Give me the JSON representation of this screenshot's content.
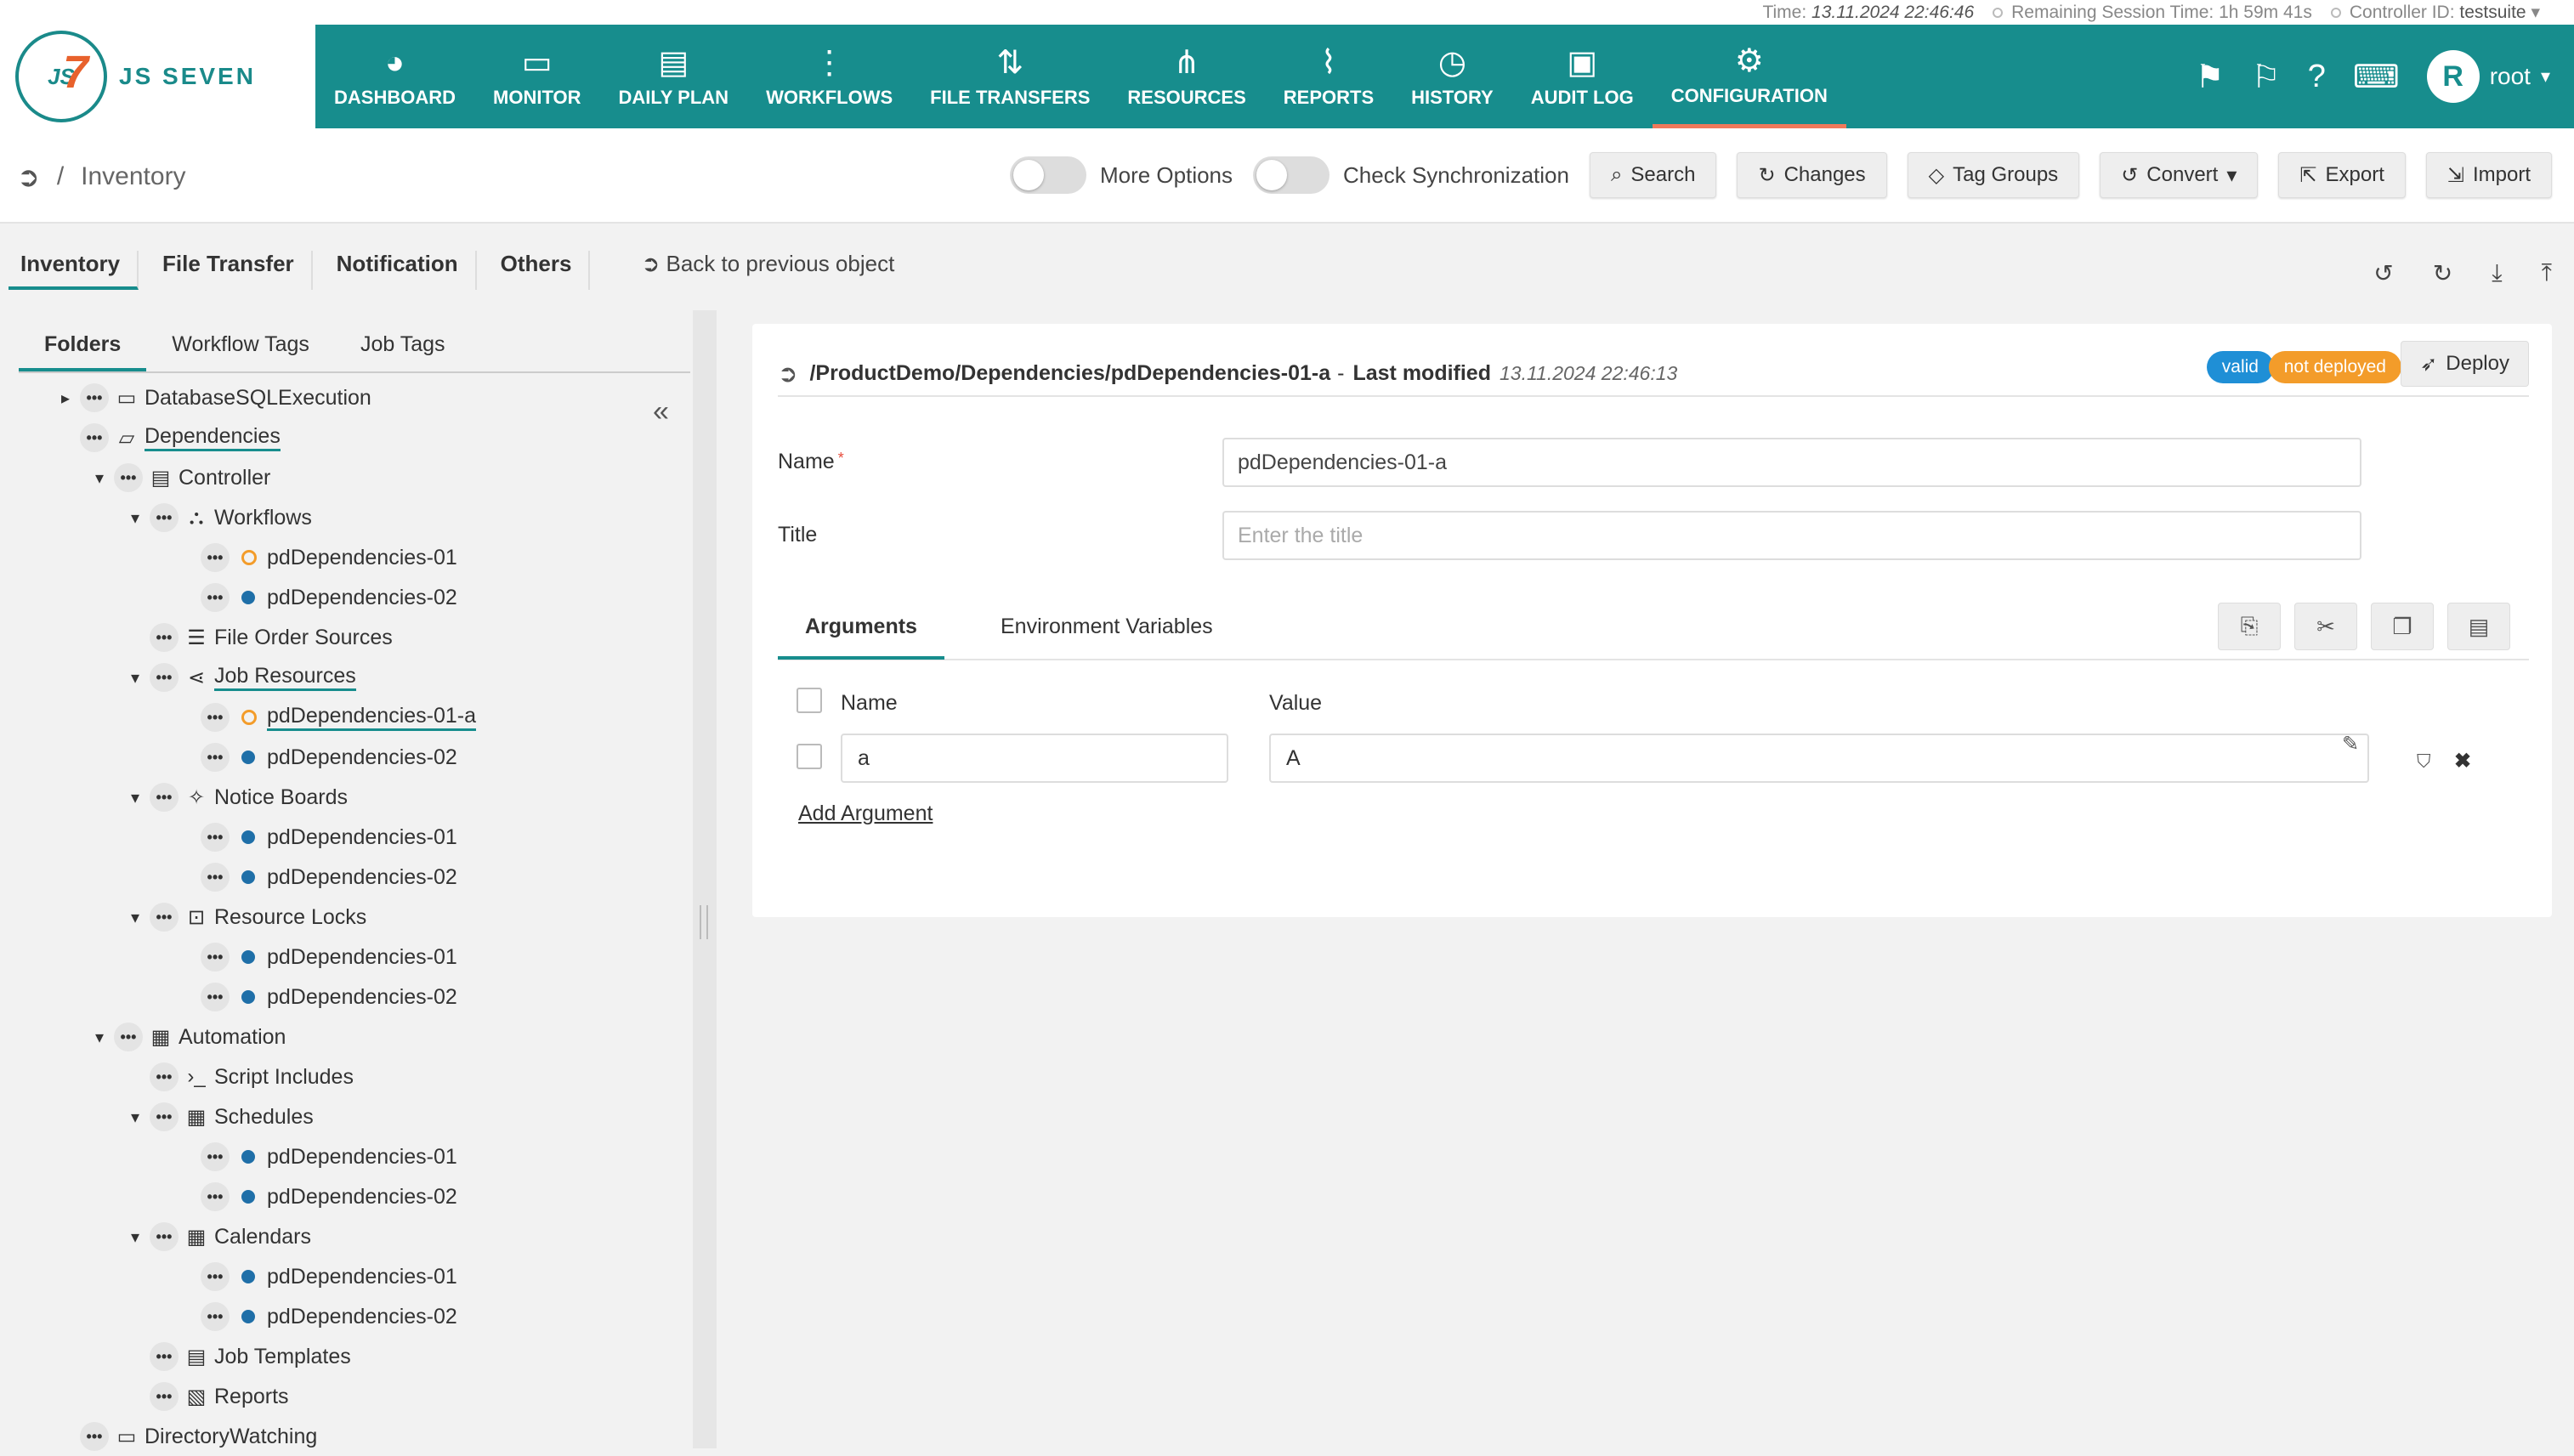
{
  "status": {
    "time_label": "Time:",
    "time_value": "13.11.2024 22:46:46",
    "session_label": "Remaining Session Time:",
    "session_value": "1h 59m 41s",
    "controller_label": "Controller ID:",
    "controller_value": "testsuite"
  },
  "logo": {
    "mark": "JS",
    "seven": "7",
    "word": "JS SEVEN"
  },
  "nav": {
    "items": [
      {
        "label": "DASHBOARD",
        "icon": "◕"
      },
      {
        "label": "MONITOR",
        "icon": "▭"
      },
      {
        "label": "DAILY PLAN",
        "icon": "▤"
      },
      {
        "label": "WORKFLOWS",
        "icon": "⋮"
      },
      {
        "label": "FILE TRANSFERS",
        "icon": "⇅"
      },
      {
        "label": "RESOURCES",
        "icon": "⋔"
      },
      {
        "label": "REPORTS",
        "icon": "⌇"
      },
      {
        "label": "HISTORY",
        "icon": "◷"
      },
      {
        "label": "AUDIT LOG",
        "icon": "▣"
      },
      {
        "label": "CONFIGURATION",
        "icon": "⚙"
      }
    ],
    "active": "CONFIGURATION",
    "user": {
      "initial": "R",
      "name": "root"
    }
  },
  "toolbar": {
    "breadcrumb": "Inventory",
    "more_options": "More Options",
    "check_sync": "Check Synchronization",
    "search": "Search",
    "changes": "Changes",
    "tag_groups": "Tag Groups",
    "convert": "Convert",
    "export": "Export",
    "import": "Import"
  },
  "tabs": {
    "items": [
      "Inventory",
      "File Transfer",
      "Notification",
      "Others"
    ],
    "back_prev": "Back to previous object"
  },
  "sidebar": {
    "tabs": [
      "Folders",
      "Workflow Tags",
      "Job Tags"
    ],
    "tree": [
      {
        "label": "DatabaseSQLExecution",
        "level": 0,
        "arrow": "▸",
        "icon": "folder"
      },
      {
        "label": "Dependencies",
        "level": 0,
        "arrow": "",
        "icon": "folder-open",
        "selected": true
      },
      {
        "label": "Controller",
        "level": 1,
        "arrow": "▾",
        "icon": "controller"
      },
      {
        "label": "Workflows",
        "level": 2,
        "arrow": "▾",
        "icon": "workflow"
      },
      {
        "label": "pdDependencies-01",
        "level": 3,
        "arrow": "",
        "icon": "orange-dot"
      },
      {
        "label": "pdDependencies-02",
        "level": 3,
        "arrow": "",
        "icon": "blue-dot"
      },
      {
        "label": "File Order Sources",
        "level": 2,
        "arrow": "",
        "icon": "list"
      },
      {
        "label": "Job Resources",
        "level": 2,
        "arrow": "▾",
        "icon": "share",
        "selected": true
      },
      {
        "label": "pdDependencies-01-a",
        "level": 3,
        "arrow": "",
        "icon": "orange-dot",
        "selected": true
      },
      {
        "label": "pdDependencies-02",
        "level": 3,
        "arrow": "",
        "icon": "blue-dot"
      },
      {
        "label": "Notice Boards",
        "level": 2,
        "arrow": "▾",
        "icon": "pin"
      },
      {
        "label": "pdDependencies-01",
        "level": 3,
        "arrow": "",
        "icon": "blue-dot"
      },
      {
        "label": "pdDependencies-02",
        "level": 3,
        "arrow": "",
        "icon": "blue-dot"
      },
      {
        "label": "Resource Locks",
        "level": 2,
        "arrow": "▾",
        "icon": "lock"
      },
      {
        "label": "pdDependencies-01",
        "level": 3,
        "arrow": "",
        "icon": "blue-dot"
      },
      {
        "label": "pdDependencies-02",
        "level": 3,
        "arrow": "",
        "icon": "blue-dot"
      },
      {
        "label": "Automation",
        "level": 1,
        "arrow": "▾",
        "icon": "calendar-clock"
      },
      {
        "label": "Script Includes",
        "level": 2,
        "arrow": "",
        "icon": "terminal"
      },
      {
        "label": "Schedules",
        "level": 2,
        "arrow": "▾",
        "icon": "schedule"
      },
      {
        "label": "pdDependencies-01",
        "level": 3,
        "arrow": "",
        "icon": "blue-dot"
      },
      {
        "label": "pdDependencies-02",
        "level": 3,
        "arrow": "",
        "icon": "blue-dot"
      },
      {
        "label": "Calendars",
        "level": 2,
        "arrow": "▾",
        "icon": "calendar"
      },
      {
        "label": "pdDependencies-01",
        "level": 3,
        "arrow": "",
        "icon": "blue-dot"
      },
      {
        "label": "pdDependencies-02",
        "level": 3,
        "arrow": "",
        "icon": "blue-dot"
      },
      {
        "label": "Job Templates",
        "level": 2,
        "arrow": "",
        "icon": "template"
      },
      {
        "label": "Reports",
        "level": 2,
        "arrow": "",
        "icon": "report"
      },
      {
        "label": "DirectoryWatching",
        "level": 0,
        "arrow": "",
        "icon": "folder"
      }
    ]
  },
  "panel": {
    "path": "/ProductDemo/Dependencies/pdDependencies-01-a",
    "dash": "-",
    "last_modified_label": "Last modified",
    "last_modified_value": "13.11.2024 22:46:13",
    "valid_badge": "valid",
    "deploy_badge": "not deployed",
    "deploy_button": "Deploy",
    "name_label": "Name",
    "name_value": "pdDependencies-01-a",
    "title_label": "Title",
    "title_placeholder": "Enter the title",
    "tabs": [
      "Arguments",
      "Environment Variables"
    ],
    "col_name": "Name",
    "col_value": "Value",
    "arg_name": "a",
    "arg_value": "A",
    "add_argument": "Add Argument"
  },
  "colors": {
    "nav": "#178d8d",
    "accent_underline": "#f0795b",
    "valid": "#1f8fd6",
    "not_deployed": "#f39c2a"
  }
}
